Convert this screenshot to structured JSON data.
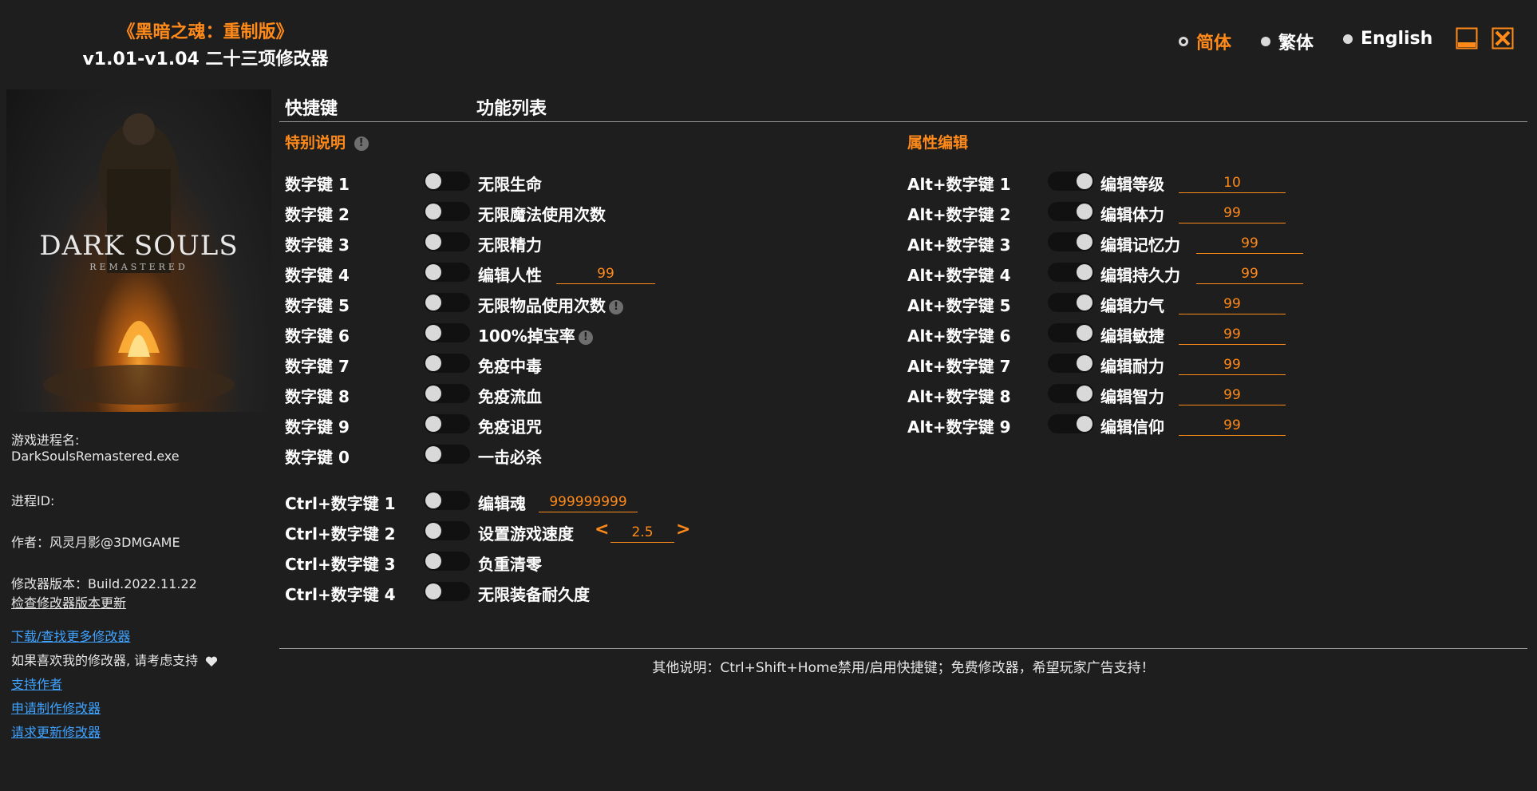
{
  "app": {
    "title": "《黑暗之魂：重制版》",
    "subtitle": "v1.01-v1.04 二十三项修改器"
  },
  "languages": [
    {
      "label": "简体",
      "selected": true
    },
    {
      "label": "繁体",
      "selected": false
    },
    {
      "label": "English",
      "selected": false
    }
  ],
  "window_buttons": {
    "minimize_icon": "minimize-icon",
    "close_icon": "close-icon"
  },
  "cover": {
    "title": "DARK SOULS",
    "subtitle": "REMASTERED"
  },
  "sidebar": {
    "process_label": "游戏进程名:",
    "process_value": "DarkSoulsRemastered.exe",
    "pid_label": "进程ID:",
    "author": "作者：风灵月影@3DMGAME",
    "version": "修改器版本：Build.2022.11.22",
    "check_update": "检查修改器版本更新",
    "download_more": "下载/查找更多修改器",
    "support_text": "如果喜欢我的修改器, 请考虑支持",
    "support_author": "支持作者",
    "request_trainer": "申请制作修改器",
    "request_update": "请求更新修改器"
  },
  "headers": {
    "hotkey": "快捷键",
    "features": "功能列表"
  },
  "sections": {
    "special": "特别说明",
    "attributes": "属性编辑"
  },
  "left_rows": [
    {
      "key": "数字键 1",
      "label": "无限生命"
    },
    {
      "key": "数字键 2",
      "label": "无限魔法使用次数"
    },
    {
      "key": "数字键 3",
      "label": "无限精力"
    },
    {
      "key": "数字键 4",
      "label": "编辑人性",
      "value": "99"
    },
    {
      "key": "数字键 5",
      "label": "无限物品使用次数",
      "info": "!"
    },
    {
      "key": "数字键 6",
      "label": "100%掉宝率",
      "info": "!"
    },
    {
      "key": "数字键 7",
      "label": "免疫中毒"
    },
    {
      "key": "数字键 8",
      "label": "免疫流血"
    },
    {
      "key": "数字键 9",
      "label": "免疫诅咒"
    },
    {
      "key": "数字键 0",
      "label": "一击必杀"
    }
  ],
  "ctrl_rows": [
    {
      "key": "Ctrl+数字键 1",
      "label": "编辑魂",
      "value": "999999999"
    },
    {
      "key": "Ctrl+数字键 2",
      "label": "设置游戏速度",
      "value": "2.5",
      "prev": "<",
      "next": ">"
    },
    {
      "key": "Ctrl+数字键 3",
      "label": "负重清零"
    },
    {
      "key": "Ctrl+数字键 4",
      "label": "无限装备耐久度"
    }
  ],
  "right_rows": [
    {
      "key": "Alt+数字键 1",
      "label": "编辑等级",
      "value": "10"
    },
    {
      "key": "Alt+数字键 2",
      "label": "编辑体力",
      "value": "99"
    },
    {
      "key": "Alt+数字键 3",
      "label": "编辑记忆力",
      "value": "99"
    },
    {
      "key": "Alt+数字键 4",
      "label": "编辑持久力",
      "value": "99"
    },
    {
      "key": "Alt+数字键 5",
      "label": "编辑力气",
      "value": "99"
    },
    {
      "key": "Alt+数字键 6",
      "label": "编辑敏捷",
      "value": "99"
    },
    {
      "key": "Alt+数字键 7",
      "label": "编辑耐力",
      "value": "99"
    },
    {
      "key": "Alt+数字键 8",
      "label": "编辑智力",
      "value": "99"
    },
    {
      "key": "Alt+数字键 9",
      "label": "编辑信仰",
      "value": "99"
    }
  ],
  "footer": "其他说明：Ctrl+Shift+Home禁用/启用快捷键；免费修改器，希望玩家广告支持！",
  "colors": {
    "accent": "#ff8a1a",
    "background": "#1e1e1e",
    "link": "#3fa2ff"
  }
}
